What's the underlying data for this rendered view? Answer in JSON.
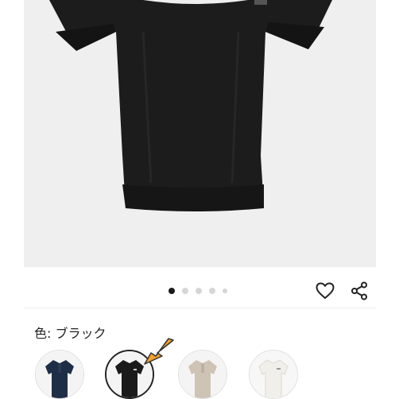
{
  "gallery": {
    "slide_count": 5,
    "active_slide": 1
  },
  "actions": {
    "favorite_icon": "heart-outline-icon",
    "share_icon": "share-icon"
  },
  "color_selector": {
    "label": "色: ブラック",
    "selected": "ブラック",
    "swatches": [
      {
        "name": "navy-polo",
        "color": "#1f2e47"
      },
      {
        "name": "black-polo",
        "color": "#1b1b1b",
        "selected": true
      },
      {
        "name": "beige-polo",
        "color": "#cfc3b6"
      },
      {
        "name": "white-polo",
        "color": "#f1efea"
      }
    ]
  },
  "colors": {
    "shirt": "#1c1c1c",
    "photo_background": "#efefef",
    "pointer_arrow": "#f2a22c",
    "active_dot": "#1a1a1a",
    "inactive_dot": "#d6d6d6"
  }
}
